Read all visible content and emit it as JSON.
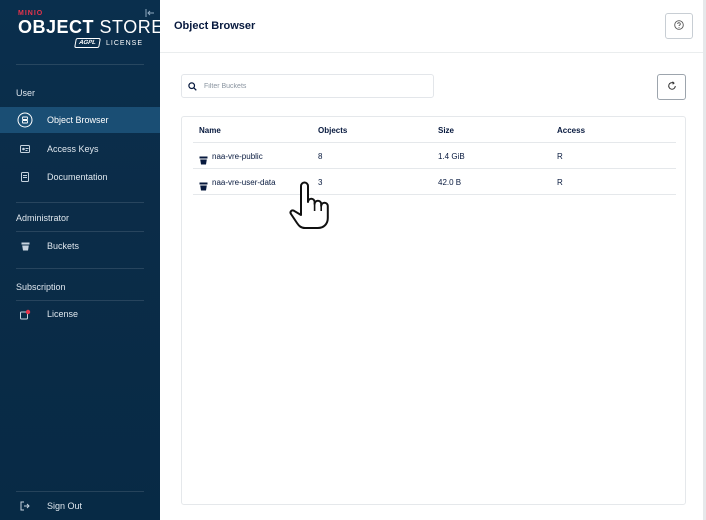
{
  "sidebar": {
    "logo": {
      "brand": "MINIO",
      "product_bold": "OBJECT",
      "product_light": " STORE",
      "badge": "AGPL",
      "edition": "LICENSE"
    },
    "sections": [
      {
        "label": "User",
        "items": [
          {
            "label": "Object Browser",
            "icon": "object-browser-icon",
            "active": true
          },
          {
            "label": "Access Keys",
            "icon": "access-keys-icon"
          },
          {
            "label": "Documentation",
            "icon": "documentation-icon"
          }
        ]
      },
      {
        "label": "Administrator",
        "items": [
          {
            "label": "Buckets",
            "icon": "bucket-icon"
          }
        ]
      },
      {
        "label": "Subscription",
        "items": [
          {
            "label": "License",
            "icon": "license-icon"
          }
        ]
      }
    ],
    "sign_out": {
      "label": "Sign Out",
      "icon": "sign-out-icon"
    }
  },
  "header": {
    "title": "Object Browser",
    "help_icon": "help-icon"
  },
  "main": {
    "filter": {
      "placeholder": "Filter Buckets",
      "value": "",
      "icon": "search-icon"
    },
    "refresh_icon": "refresh-icon",
    "table": {
      "columns": [
        "Name",
        "Objects",
        "Size",
        "Access"
      ],
      "rows": [
        {
          "name": "naa-vre-public",
          "objects": "8",
          "size": "1.4 GiB",
          "access": "R"
        },
        {
          "name": "naa-vre-user-data",
          "objects": "3",
          "size": "42.0 B",
          "access": "R"
        }
      ]
    }
  },
  "colors": {
    "sidebar_bg": "#0b2c48",
    "active_item": "#1a4e74",
    "title_text": "#07193e",
    "brand_red": "#e8334b"
  }
}
